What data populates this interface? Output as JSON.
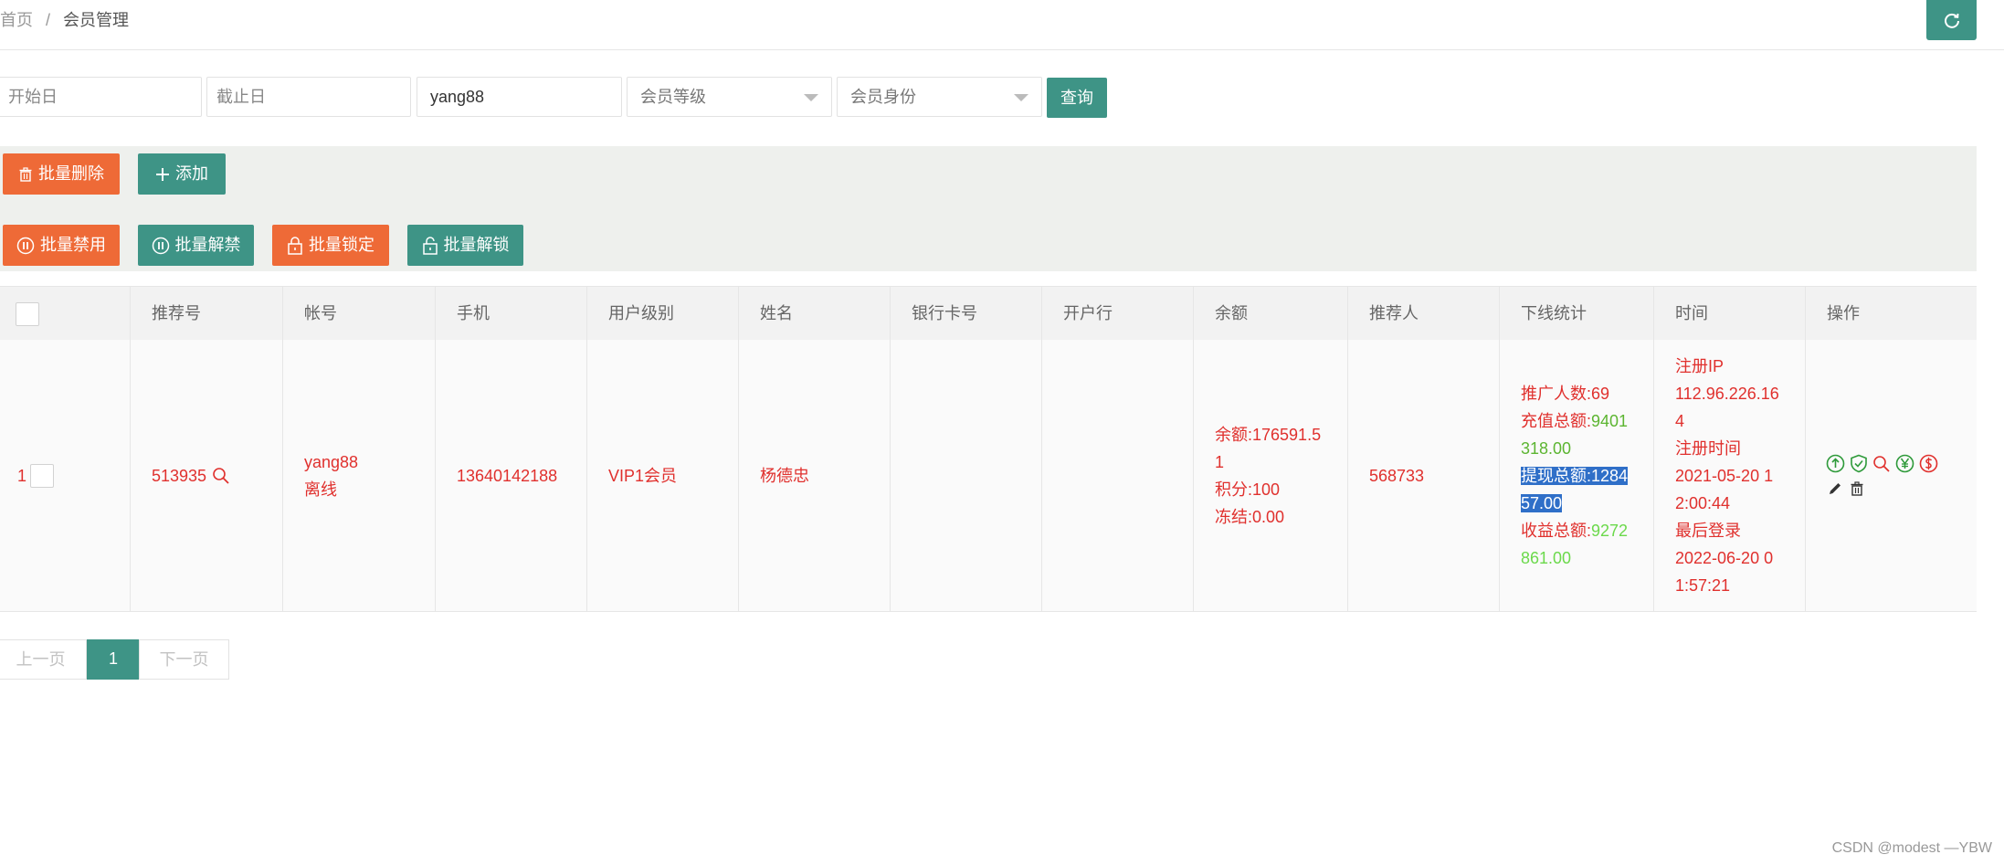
{
  "breadcrumb": {
    "home": "首页",
    "separator": "/",
    "current": "会员管理"
  },
  "header": {
    "refresh_icon": "refresh-icon"
  },
  "search": {
    "start_date_placeholder": "开始日",
    "end_date_placeholder": "截止日",
    "account_value": "yang88",
    "member_level_selected": "会员等级",
    "member_identity_selected": "会员身份",
    "query_label": "查询"
  },
  "toolbar": {
    "batch_delete": "批量删除",
    "add": "添加",
    "batch_disable": "批量禁用",
    "batch_unban": "批量解禁",
    "batch_lock": "批量锁定",
    "batch_unlock": "批量解锁"
  },
  "table": {
    "columns": [
      "推荐号",
      "帐号",
      "手机",
      "用户级别",
      "姓名",
      "银行卡号",
      "开户行",
      "余额",
      "推荐人",
      "下线统计",
      "时间",
      "操作"
    ],
    "rows": [
      {
        "index": "1",
        "referral_code": "513935",
        "account": "yang88",
        "status": "离线",
        "phone": "13640142188",
        "level": "VIP1会员",
        "name": "杨德忠",
        "bank_card": "",
        "bank": "",
        "balance_line1": "余额:176591.5",
        "balance_line2": "1",
        "points": "积分:100",
        "frozen": "冻结:0.00",
        "referrer": "568733",
        "downline": {
          "promoters_label": "推广人数:",
          "promoters": "69",
          "recharge_label": "充值总额:",
          "recharge_a": "9401",
          "recharge_b": "318.00",
          "withdraw_label": "提现总额:",
          "withdraw_a": "1284",
          "withdraw_b": "57.00",
          "income_label": "收益总额:",
          "income_a": "9272",
          "income_b": "861.00"
        },
        "time": {
          "reg_ip_label": "注册IP",
          "reg_ip_a": "112.96.226.16",
          "reg_ip_b": "4",
          "reg_time_label": "注册时间",
          "reg_time_a": "2021-05-20 1",
          "reg_time_b": "2:00:44",
          "last_login_label": "最后登录",
          "last_login_a": "2022-06-20 0",
          "last_login_b": "1:57:21"
        },
        "actions": [
          "arrow-up-icon",
          "shield-check-icon",
          "search-icon",
          "yen-icon",
          "dollar-icon",
          "edit-icon",
          "trash-icon"
        ]
      }
    ]
  },
  "pagination": {
    "prev": "上一页",
    "current": "1",
    "next": "下一页"
  },
  "footer": {
    "credit": "CSDN @modest —YBW"
  },
  "colors": {
    "teal": "#3e9486",
    "orange": "#ee6a37",
    "red": "#e0302d",
    "green": "#5cb531"
  }
}
